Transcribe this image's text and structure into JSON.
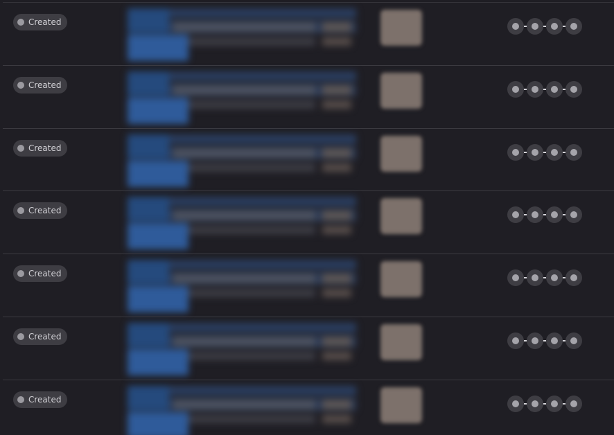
{
  "table": {
    "rows": [
      {
        "status": "Created",
        "status_color": "#9b9aa0",
        "steps": 4
      },
      {
        "status": "Created",
        "status_color": "#9b9aa0",
        "steps": 4
      },
      {
        "status": "Created",
        "status_color": "#9b9aa0",
        "steps": 4
      },
      {
        "status": "Created",
        "status_color": "#9b9aa0",
        "steps": 4
      },
      {
        "status": "Created",
        "status_color": "#9b9aa0",
        "steps": 4
      },
      {
        "status": "Created",
        "status_color": "#9b9aa0",
        "steps": 4
      },
      {
        "status": "Created",
        "status_color": "#9b9aa0",
        "steps": 4
      }
    ]
  },
  "icons": {
    "status": "status-dot-icon",
    "step": "pipeline-step-icon"
  },
  "colors": {
    "background": "#1f1e24",
    "pill": "#3e3d43",
    "text": "#cfced3",
    "accent_blue": "#2f5b9a"
  }
}
